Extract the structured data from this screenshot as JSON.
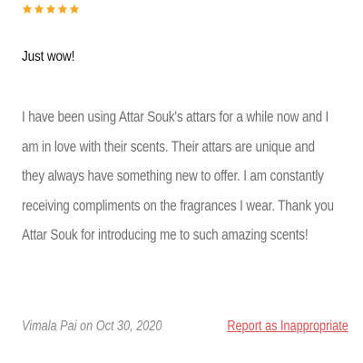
{
  "review": {
    "rating": 5,
    "star_color": "#f5a623",
    "star_icon": "star-icon",
    "title": "Just wow!",
    "body": "I have been using Attar Souk's attars for a while now and I am in love with their scents. Their attars are unique and they always have something new to offer. I am constantly receiving compliments on the fragrances I wear. Thank you Attar Souk for introducing me to such amazing scents!",
    "author_line": "Vimala Pai on Oct 30, 2020",
    "report_label": "Report as Inappropriate",
    "report_color": "#d9534f"
  }
}
